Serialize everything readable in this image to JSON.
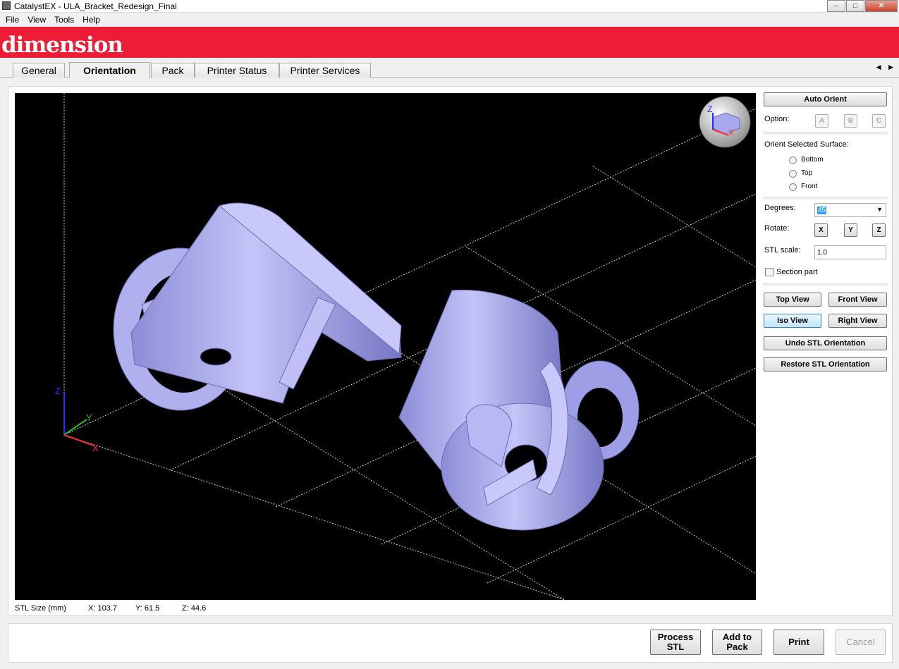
{
  "window": {
    "title": "CatalystEX - ULA_Bracket_Redesign_Final",
    "minimize": "–",
    "maximize": "□",
    "close": "✕"
  },
  "menu": [
    "File",
    "View",
    "Tools",
    "Help"
  ],
  "brand": {
    "logo": "dimension",
    "bar_color": "#ee1d36"
  },
  "tabs": [
    {
      "label": "General"
    },
    {
      "label": "Orientation",
      "active": true
    },
    {
      "label": "Pack"
    },
    {
      "label": "Printer Status"
    },
    {
      "label": "Printer Services"
    }
  ],
  "tab_scroll": "◀ ▶",
  "viewport": {
    "background": "#000000",
    "part_color": "#a8a8ee",
    "axis_labels": {
      "x": "X",
      "y": "Y",
      "z": "Z"
    },
    "cube_labels": {
      "x": "X",
      "z": "Z"
    }
  },
  "stl_size": {
    "label": "STL Size (mm)",
    "x": "X:  103.7",
    "y": "Y:  61.5",
    "z": "Z:  44.6"
  },
  "sidebar": {
    "auto_orient": "Auto Orient",
    "option_label": "Option:",
    "options": [
      "A",
      "B",
      "C"
    ],
    "orient_surface_label": "Orient Selected Surface:",
    "surfaces": [
      "Bottom",
      "Top",
      "Front"
    ],
    "degrees_label": "Degrees:",
    "degrees_value": "45",
    "rotate_label": "Rotate:",
    "rotate_axes": [
      "X",
      "Y",
      "Z"
    ],
    "stl_scale_label": "STL scale:",
    "stl_scale_value": "1.0",
    "section_part": "Section part",
    "top_view": "Top View",
    "front_view": "Front View",
    "iso_view": "Iso View",
    "right_view": "Right View",
    "undo_orientation": "Undo STL Orientation",
    "restore_orientation": "Restore STL Orientation"
  },
  "actions": {
    "process": "Process\nSTL",
    "add_to_pack": "Add to\nPack",
    "print": "Print",
    "cancel": "Cancel"
  }
}
